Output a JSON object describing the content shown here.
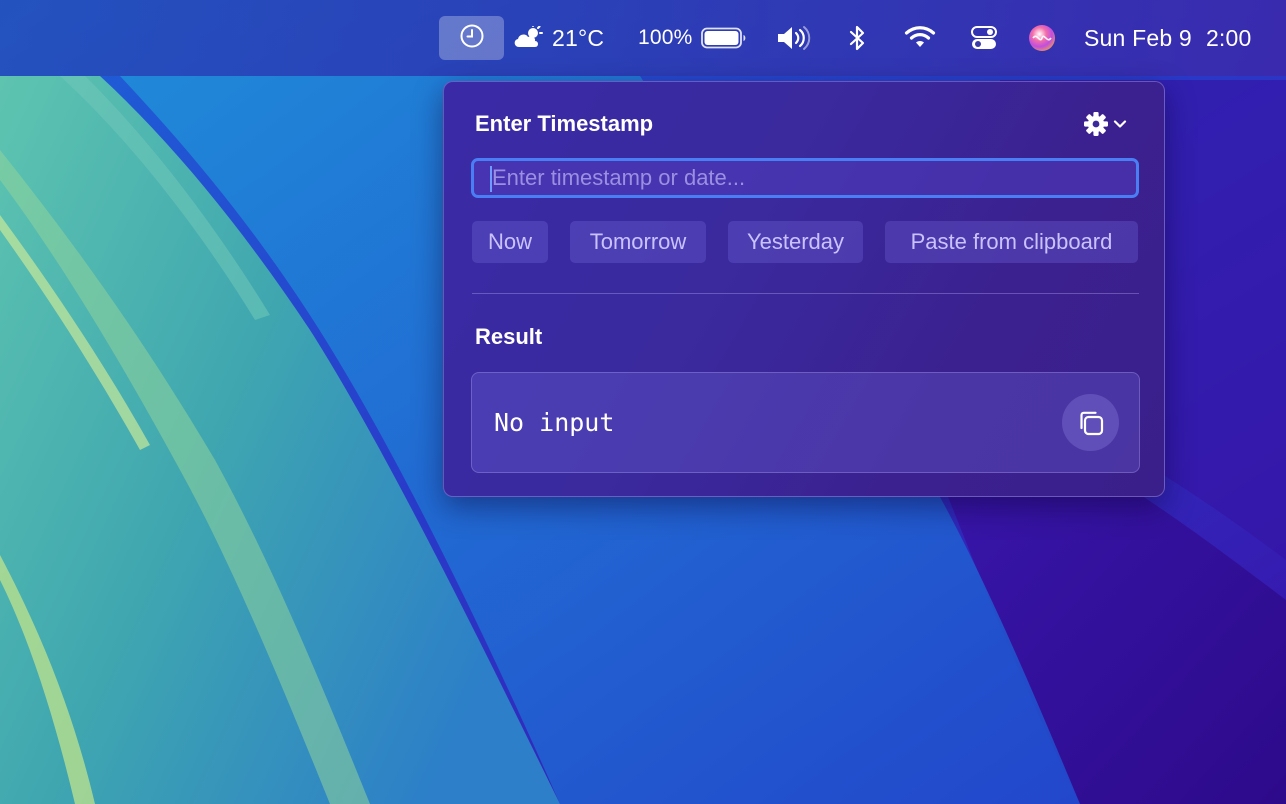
{
  "menubar": {
    "weather": {
      "icon": "cloud-sun-icon",
      "temperature": "21°C"
    },
    "battery": {
      "percent_label": "100%",
      "level": 1.0,
      "icon": "battery-icon"
    },
    "icons": [
      "clock-icon",
      "volume-icon",
      "bluetooth-icon",
      "wifi-icon",
      "control-center-icon",
      "siri-icon"
    ],
    "datetime": {
      "date": "Sun Feb 9",
      "time": "2:00"
    }
  },
  "popover": {
    "title": "Enter Timestamp",
    "settings_icon": "gear-icon",
    "input": {
      "value": "",
      "placeholder": "Enter timestamp or date..."
    },
    "quick_buttons": [
      "Now",
      "Tomorrow",
      "Yesterday",
      "Paste from clipboard"
    ],
    "result": {
      "title": "Result",
      "value": "No input",
      "copy_icon": "copy-icon"
    }
  },
  "colors": {
    "accent": "#4a7ef5",
    "popover_bg": "#3a2a9e",
    "button_text": "#c9c2ff"
  }
}
